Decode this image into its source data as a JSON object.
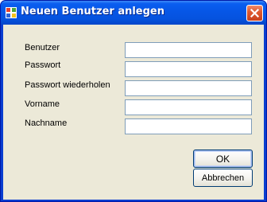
{
  "window": {
    "title": "Neuen Benutzer anlegen",
    "close_icon": "close-icon",
    "app_icon": "windows-app-icon"
  },
  "form": {
    "fields": [
      {
        "label": "Benutzer",
        "value": ""
      },
      {
        "label": "Passwort",
        "value": ""
      },
      {
        "label": "Passwort wiederholen",
        "value": ""
      },
      {
        "label": "Vorname",
        "value": ""
      },
      {
        "label": "Nachname",
        "value": ""
      }
    ]
  },
  "buttons": {
    "ok_label": "OK",
    "cancel_label": "Abbrechen"
  },
  "colors": {
    "titlebar": "#0656e6",
    "client_background": "#ece9d8",
    "field_border": "#7f9db9",
    "button_border": "#003c74"
  }
}
